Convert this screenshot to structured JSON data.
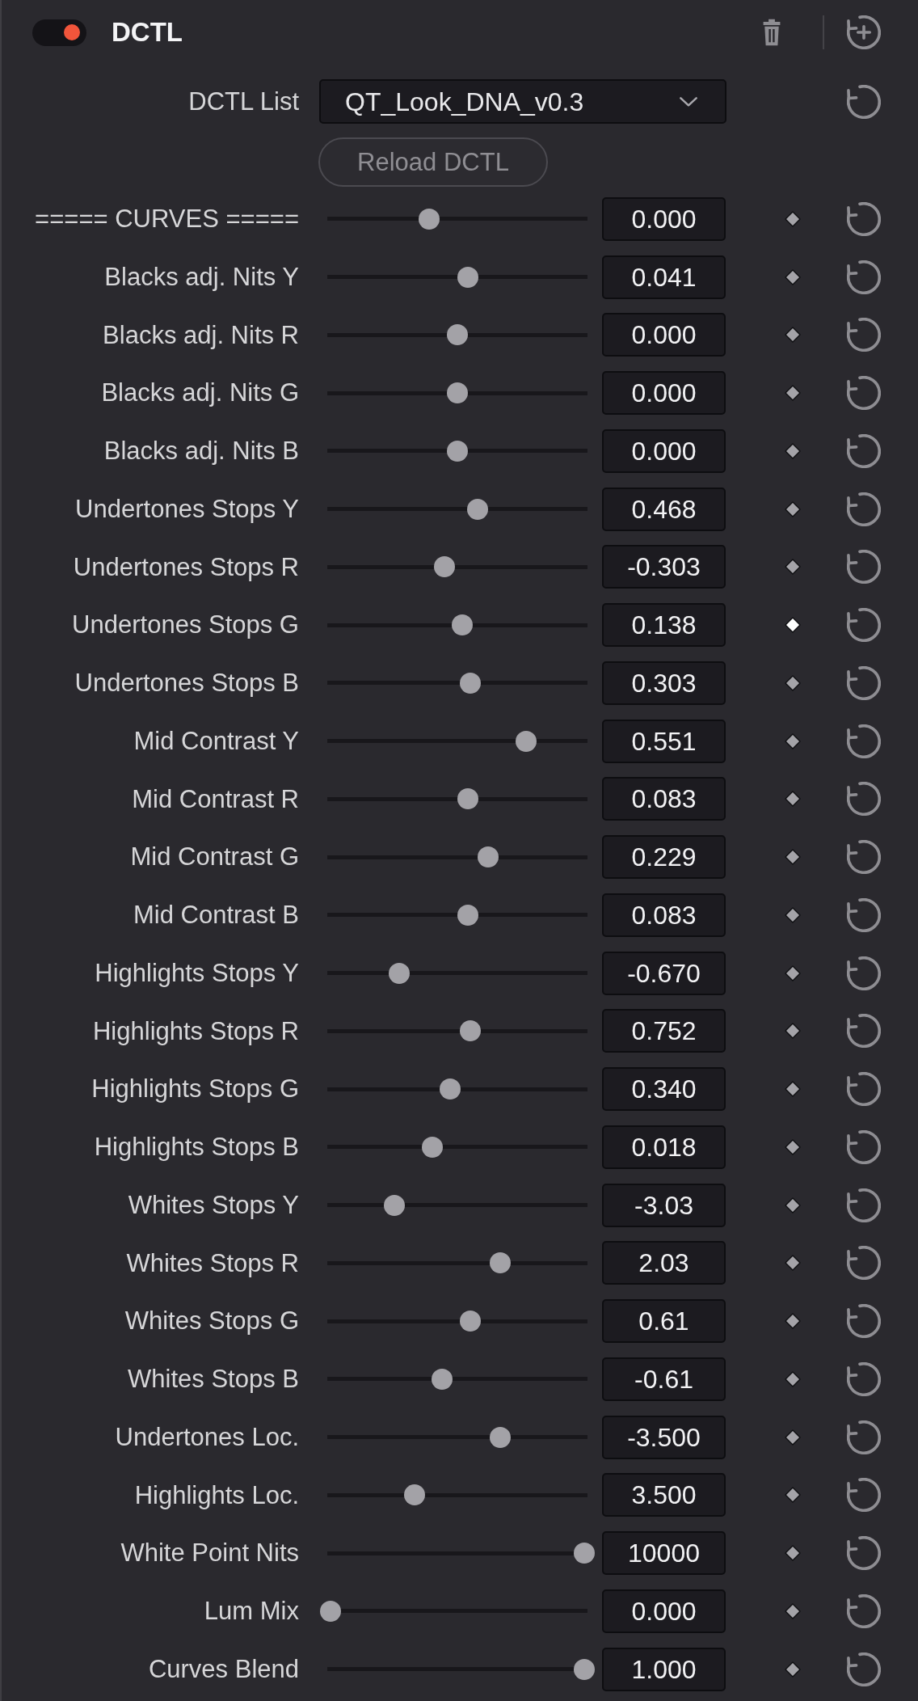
{
  "header": {
    "title": "DCTL",
    "enabled": true
  },
  "dctl_list": {
    "label": "DCTL List",
    "value": "QT_Look_DNA_v0.3"
  },
  "reload_button": "Reload DCTL",
  "parameters": [
    {
      "label": "===== CURVES =====",
      "level": 0.39,
      "value": "0.000",
      "keyframe_highlighted": false
    },
    {
      "label": "Blacks adj. Nits Y",
      "level": 0.54,
      "value": "0.041",
      "keyframe_highlighted": false
    },
    {
      "label": "Blacks adj. Nits R",
      "level": 0.5,
      "value": "0.000",
      "keyframe_highlighted": false
    },
    {
      "label": "Blacks adj. Nits G",
      "level": 0.5,
      "value": "0.000",
      "keyframe_highlighted": false
    },
    {
      "label": "Blacks adj. Nits B",
      "level": 0.5,
      "value": "0.000",
      "keyframe_highlighted": false
    },
    {
      "label": "Undertones Stops Y",
      "level": 0.58,
      "value": "0.468",
      "keyframe_highlighted": false
    },
    {
      "label": "Undertones Stops R",
      "level": 0.45,
      "value": "-0.303",
      "keyframe_highlighted": false
    },
    {
      "label": "Undertones Stops G",
      "level": 0.52,
      "value": "0.138",
      "keyframe_highlighted": true
    },
    {
      "label": "Undertones Stops B",
      "level": 0.55,
      "value": "0.303",
      "keyframe_highlighted": false
    },
    {
      "label": "Mid Contrast Y",
      "level": 0.77,
      "value": "0.551",
      "keyframe_highlighted": false
    },
    {
      "label": "Mid Contrast R",
      "level": 0.54,
      "value": "0.083",
      "keyframe_highlighted": false
    },
    {
      "label": "Mid Contrast G",
      "level": 0.62,
      "value": "0.229",
      "keyframe_highlighted": false
    },
    {
      "label": "Mid Contrast B",
      "level": 0.54,
      "value": "0.083",
      "keyframe_highlighted": false
    },
    {
      "label": "Highlights Stops Y",
      "level": 0.27,
      "value": "-0.670",
      "keyframe_highlighted": false
    },
    {
      "label": "Highlights Stops R",
      "level": 0.55,
      "value": "0.752",
      "keyframe_highlighted": false
    },
    {
      "label": "Highlights Stops G",
      "level": 0.47,
      "value": "0.340",
      "keyframe_highlighted": false
    },
    {
      "label": "Highlights Stops B",
      "level": 0.4,
      "value": "0.018",
      "keyframe_highlighted": false
    },
    {
      "label": "Whites Stops Y",
      "level": 0.25,
      "value": "-3.03",
      "keyframe_highlighted": false
    },
    {
      "label": "Whites Stops R",
      "level": 0.67,
      "value": "2.03",
      "keyframe_highlighted": false
    },
    {
      "label": "Whites Stops G",
      "level": 0.55,
      "value": "0.61",
      "keyframe_highlighted": false
    },
    {
      "label": "Whites Stops B",
      "level": 0.44,
      "value": "-0.61",
      "keyframe_highlighted": false
    },
    {
      "label": "Undertones Loc.",
      "level": 0.67,
      "value": "-3.500",
      "keyframe_highlighted": false
    },
    {
      "label": "Highlights Loc.",
      "level": 0.33,
      "value": "3.500",
      "keyframe_highlighted": false
    },
    {
      "label": "White Point Nits",
      "level": 1.0,
      "value": "10000",
      "keyframe_highlighted": false
    },
    {
      "label": "Lum Mix",
      "level": 0,
      "value": "0.000",
      "keyframe_highlighted": false
    },
    {
      "label": "Curves Blend",
      "level": 1.0,
      "value": "1.000",
      "keyframe_highlighted": false
    }
  ]
}
